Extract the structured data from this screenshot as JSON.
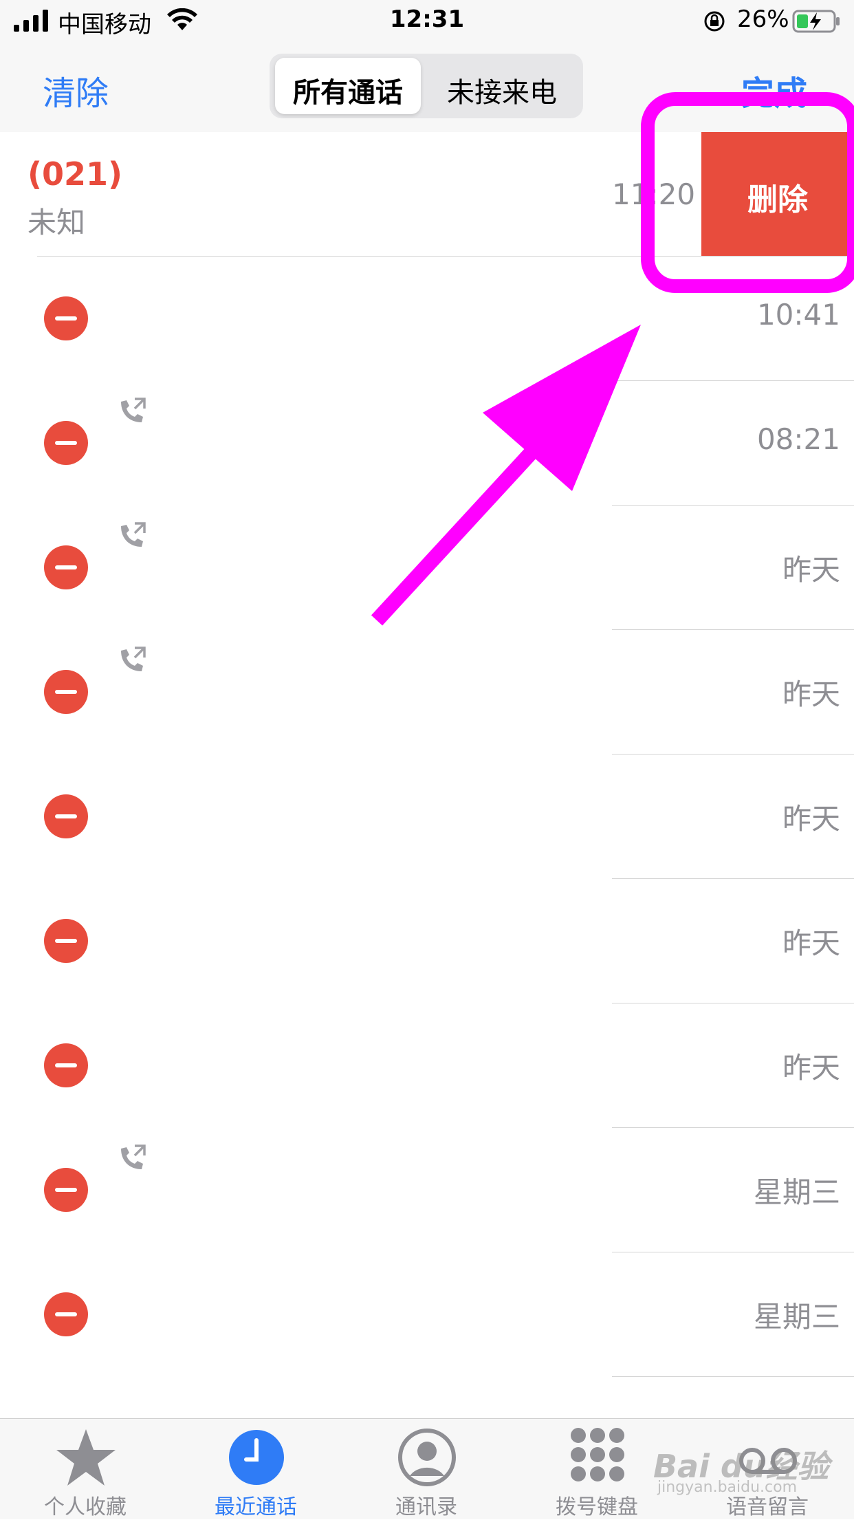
{
  "status": {
    "carrier": "中国移动",
    "time": "12:31",
    "battery": "26%"
  },
  "nav": {
    "clear": "清除",
    "segments": [
      "所有通话",
      "未接来电"
    ],
    "active_segment": "所有通话",
    "done": "完成"
  },
  "first_call": {
    "number": "(021)",
    "label": "未知",
    "time": "11:20",
    "delete": "删除"
  },
  "calls": [
    {
      "time": "10:41",
      "outgoing": false
    },
    {
      "time": "08:21",
      "outgoing": true
    },
    {
      "time": "昨天",
      "outgoing": true
    },
    {
      "time": "昨天",
      "outgoing": true
    },
    {
      "time": "昨天",
      "outgoing": false
    },
    {
      "time": "昨天",
      "outgoing": false
    },
    {
      "time": "昨天",
      "outgoing": false
    },
    {
      "time": "星期三",
      "outgoing": true
    },
    {
      "time": "星期三",
      "outgoing": false
    }
  ],
  "tabs": [
    {
      "label": "个人收藏",
      "icon": "star-icon"
    },
    {
      "label": "最近通话",
      "icon": "clock-icon",
      "active": true
    },
    {
      "label": "通讯录",
      "icon": "contact-icon"
    },
    {
      "label": "拨号键盘",
      "icon": "keypad-icon"
    },
    {
      "label": "语音留言",
      "icon": "voicemail-icon"
    }
  ],
  "colors": {
    "accent": "#2f7cf6",
    "destructive": "#e84c3d",
    "annotation": "#ff00ff"
  },
  "watermark": {
    "text": "Bai du经验",
    "url": "jingyan.baidu.com"
  }
}
